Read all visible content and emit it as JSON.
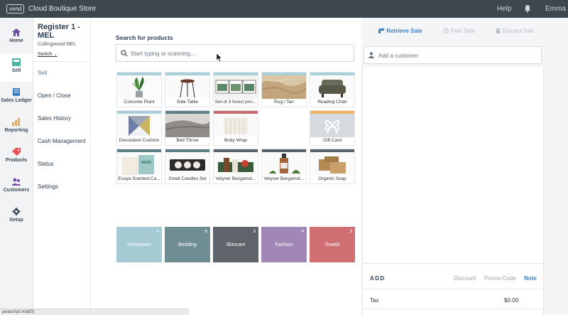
{
  "topbar": {
    "logo": "vend",
    "store_name": "Cloud Boutique Store",
    "help": "Help",
    "user": "Emma"
  },
  "nav": [
    {
      "label": "Home",
      "icon": "home-icon"
    },
    {
      "label": "Sell",
      "icon": "sell-icon",
      "active": true
    },
    {
      "label": "Sales Ledger",
      "icon": "ledger-icon"
    },
    {
      "label": "Reporting",
      "icon": "reporting-icon"
    },
    {
      "label": "Products",
      "icon": "products-icon"
    },
    {
      "label": "Customers",
      "icon": "customers-icon"
    },
    {
      "label": "Setup",
      "icon": "gear-icon"
    }
  ],
  "register": {
    "title": "Register 1 - MEL",
    "outlet": "Collingwood MEL",
    "switch": "Switch"
  },
  "menu": [
    "Sell",
    "Open / Close",
    "Sales History",
    "Cash Management",
    "Status",
    "Settings"
  ],
  "search": {
    "label": "Search for products",
    "placeholder": "Start typing or scanning..."
  },
  "products": [
    {
      "name": "Concrete Plant",
      "bar": "#a9cfd8"
    },
    {
      "name": "Side Table",
      "bar": "#a9cfd8"
    },
    {
      "name": "Set of 3 forest prin...",
      "bar": "#a9cfd8"
    },
    {
      "name": "Rug / Tan",
      "bar": "#a9cfd8"
    },
    {
      "name": "Reading Chair",
      "bar": "#a9cfd8"
    },
    {
      "name": "Decorative Cushion",
      "bar": "#a9cfd8"
    },
    {
      "name": "Bed Throw",
      "bar": "#5f7f89"
    },
    {
      "name": "Body Wrap",
      "bar": "#c46b73"
    },
    {
      "name": "Gift Card",
      "bar": "#f0b462"
    },
    {
      "name": "Ecoya Scented Ca...",
      "bar": "#5f7f89"
    },
    {
      "name": "Small Candles Set",
      "bar": "#5f7f89"
    },
    {
      "name": "Vetyver Bergamot...",
      "bar": "#5b6269"
    },
    {
      "name": "Vetyver Bergamot...",
      "bar": "#5b6269"
    },
    {
      "name": "Organic Soap",
      "bar": "#5b6269"
    }
  ],
  "categories": [
    {
      "label": "Homeware",
      "count": "3",
      "color": "#a5cad3"
    },
    {
      "label": "Bedding",
      "count": "6",
      "color": "#6f8e94"
    },
    {
      "label": "Skincare",
      "count": "3",
      "color": "#5f636a"
    },
    {
      "label": "Fashion",
      "count": "4",
      "color": "#a187b5"
    },
    {
      "label": "Towels",
      "count": "3",
      "color": "#cf6f74"
    }
  ],
  "sale": {
    "retrieve": "Retrieve Sale",
    "park": "Park Sale",
    "discard": "Discard Sale",
    "customer_placeholder": "Add a customer",
    "add": "ADD",
    "discount": "Discount",
    "promo": "Promo Code",
    "note": "Note",
    "tax_label": "Tax",
    "tax_value": "$0.00"
  },
  "status_bar": "javascript:void(0)",
  "colors": {
    "topbar": "#3d4750",
    "accent": "#3e7fc1"
  }
}
